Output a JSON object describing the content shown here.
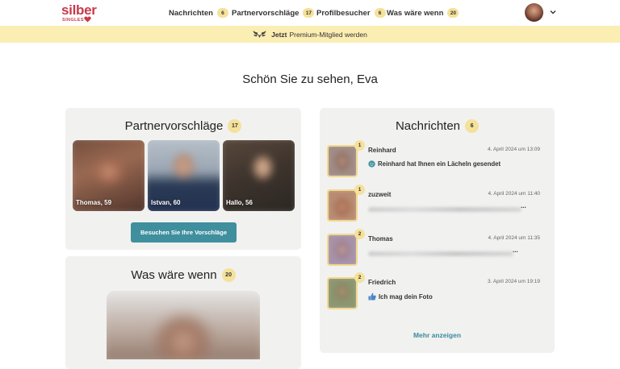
{
  "logo": {
    "word": "silber",
    "sub": "SINGLES"
  },
  "nav": [
    {
      "label": "Nachrichten",
      "badge": "6"
    },
    {
      "label": "Partnervorschläge",
      "badge": "17"
    },
    {
      "label": "Profilbesucher",
      "badge": "6"
    },
    {
      "label": "Was wäre wenn",
      "badge": "20"
    }
  ],
  "premium": {
    "bold": "Jetzt",
    "text": "Premium-Mitglied werden"
  },
  "greeting": "Schön Sie zu sehen, Eva",
  "suggestions": {
    "title": "Partnervorschläge",
    "badge": "17",
    "people": [
      {
        "name": "Thomas, 59"
      },
      {
        "name": "Istvan, 60"
      },
      {
        "name": "Hallo, 56"
      }
    ],
    "button": "Besuchen Sie Ihre Vorschläge"
  },
  "whatif": {
    "title": "Was wäre wenn",
    "badge": "20"
  },
  "messages": {
    "title": "Nachrichten",
    "badge": "6",
    "items": [
      {
        "count": "1",
        "name": "Reinhard",
        "date": "4. April 2024 um 13:09",
        "text": "Reinhard hat Ihnen ein Lächeln gesendet",
        "icon": "smile-icon"
      },
      {
        "count": "1",
        "name": "zuzweit",
        "date": "4. April 2024 um 11:40",
        "text": "",
        "trail": "..."
      },
      {
        "count": "2",
        "name": "Thomas",
        "date": "4. April 2024 um 11:35",
        "text": "",
        "trail": "..."
      },
      {
        "count": "2",
        "name": "Friedrich",
        "date": "3. April 2024 um 19:19",
        "text": "Ich mag dein Foto",
        "icon": "thumbs-up-icon"
      }
    ],
    "more": "Mehr anzeigen"
  },
  "colors": {
    "brand": "#c8384a",
    "accent": "#3f8f9e",
    "badge": "#f5e19a",
    "premium_bar": "#fbeeb3"
  }
}
